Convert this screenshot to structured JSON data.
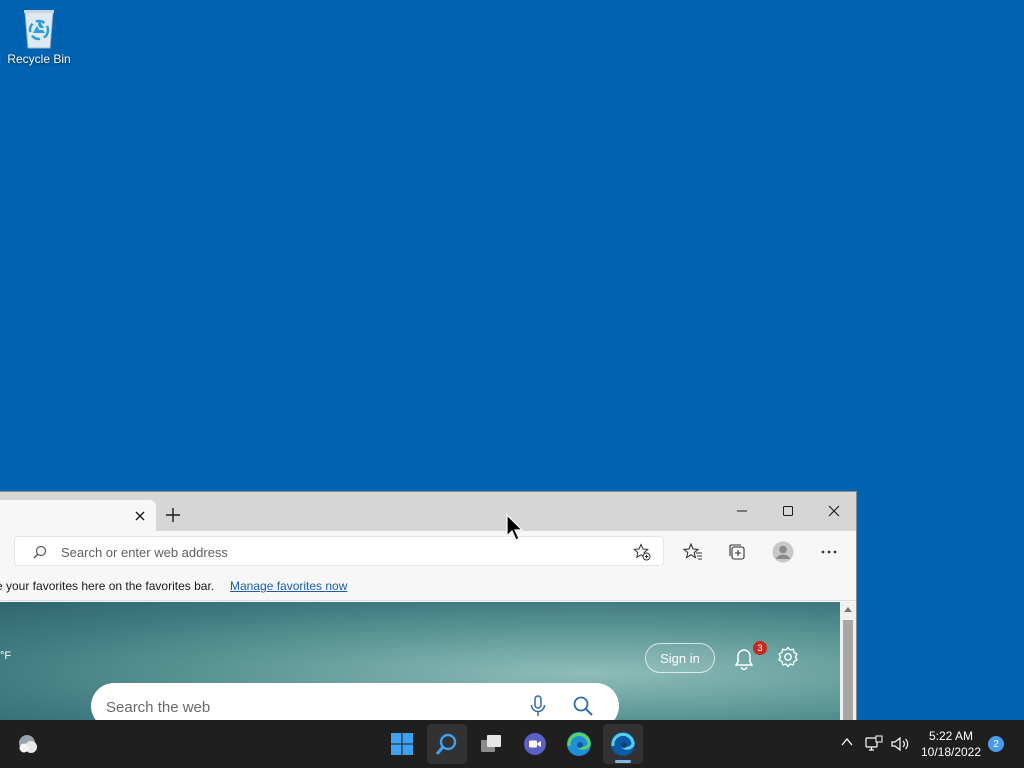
{
  "desktop": {
    "background_color": "#0063b1",
    "icons": [
      {
        "label": "Recycle Bin",
        "icon": "recycle-bin-icon"
      }
    ]
  },
  "browser": {
    "tab_close_icon": "close-icon",
    "new_tab_icon": "plus-icon",
    "window_controls": [
      "minimize-icon",
      "maximize-icon",
      "close-icon"
    ],
    "address_bar": {
      "placeholder": "Search or enter web address",
      "value": ""
    },
    "toolbar_icons": [
      "add-favorite-icon",
      "favorites-icon",
      "collections-icon",
      "profile-icon",
      "more-icon"
    ],
    "favorites_bar": {
      "message": "e your favorites here on the favorites bar.",
      "link": "Manage favorites now"
    },
    "new_tab_page": {
      "temp_unit": "°F",
      "sign_in": "Sign in",
      "notification_count": "3",
      "search": {
        "placeholder": "Search the web"
      }
    }
  },
  "taskbar": {
    "pinned": [
      "widgets-icon",
      "windows-start-icon",
      "search-icon",
      "task-view-icon",
      "teams-chat-icon",
      "edge-icon",
      "edge-dev-icon"
    ],
    "tray": {
      "time": "5:22 AM",
      "date": "10/18/2022",
      "notifications": "2"
    }
  }
}
